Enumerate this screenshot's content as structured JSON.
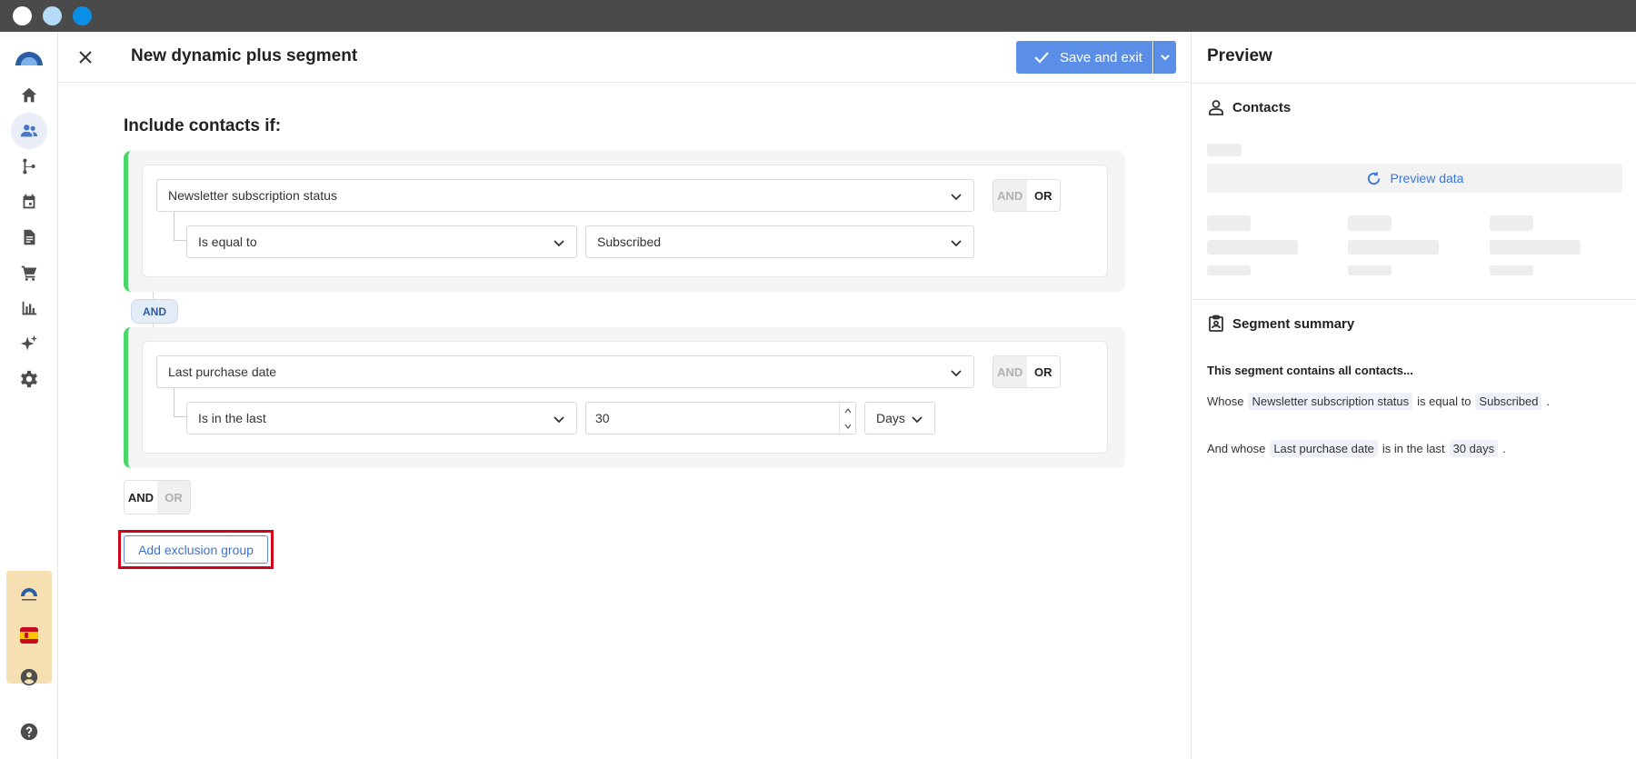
{
  "window": {
    "traffic_lights": [
      "close",
      "minimize",
      "zoom"
    ]
  },
  "sidebar": {
    "items": [
      {
        "icon": "home-icon"
      },
      {
        "icon": "contacts-icon",
        "active": true
      },
      {
        "icon": "automation-icon"
      },
      {
        "icon": "calendar-icon"
      },
      {
        "icon": "document-icon"
      },
      {
        "icon": "cart-icon"
      },
      {
        "icon": "chart-icon"
      },
      {
        "icon": "sparkle-icon"
      },
      {
        "icon": "gear-icon"
      }
    ],
    "footer": [
      "account-icon",
      "help-icon"
    ]
  },
  "header": {
    "title": "New dynamic plus segment",
    "save_label": "Save and exit"
  },
  "builder": {
    "include_title": "Include contacts if:",
    "groups": [
      {
        "field": "Newsletter subscription status",
        "operator": "Is equal to",
        "value": "Subscribed",
        "and_label": "AND",
        "or_label": "OR"
      },
      {
        "field": "Last purchase date",
        "operator": "Is in the last",
        "value": "30",
        "unit": "Days",
        "and_label": "AND",
        "or_label": "OR"
      }
    ],
    "connector_label": "AND",
    "bottom_and": "AND",
    "bottom_or": "OR",
    "exclusion_button": "Add exclusion group"
  },
  "preview": {
    "title": "Preview",
    "contacts_title": "Contacts",
    "preview_data_label": "Preview data",
    "summary_title": "Segment summary",
    "summary_lead": "This segment contains all contacts...",
    "line1": {
      "prefix": "Whose",
      "field": "Newsletter subscription status",
      "op": "is equal to",
      "value": "Subscribed",
      "end": "."
    },
    "line2": {
      "prefix": "And whose",
      "field": "Last purchase date",
      "op": "is in the last",
      "value": "30 days",
      "end": "."
    }
  },
  "colors": {
    "accent": "#5b8ee6",
    "group_border": "#4bd66a",
    "highlight": "#d0021b"
  }
}
